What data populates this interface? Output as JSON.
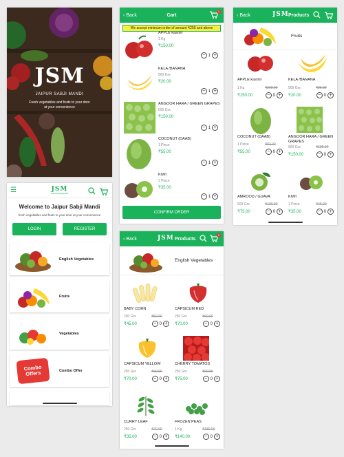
{
  "colors": {
    "brand": "#1ab25a",
    "notice": "#f8ee3c"
  },
  "splash": {
    "logo": "JSM",
    "brand": "JAIPUR SABJI MANDI",
    "tagline": "Fresh vegetables and fruits to your door at your convenience"
  },
  "home": {
    "logo": "JSM",
    "logo_sub": "JAIPUR SABJI MANDI",
    "welcome": "Welcome to Jaipur Sabji Mandi",
    "subtitle": "fresh vegetables and fruits to your door at your convenience",
    "login": "LOGIN",
    "register": "REGISTER",
    "categories": [
      {
        "label": "English Vegetables"
      },
      {
        "label": "Fruits"
      },
      {
        "label": "Vegetables"
      },
      {
        "label": "Combo Offer",
        "badge": "Combo Offers"
      }
    ]
  },
  "cart": {
    "back": "Back",
    "title": "Cart",
    "badge": "1",
    "notice": "We accept minimum order of amount ₹250 and above",
    "confirm": "CONFIRM ORDER",
    "items": [
      {
        "name": "APPLE kasmir",
        "unit": "1 Kg",
        "price": "₹150.00",
        "qty": "1"
      },
      {
        "name": "KELA /BANANA",
        "unit": "500 Grs",
        "price": "₹20.00",
        "qty": "1"
      },
      {
        "name": "ANGOOR HARA / GREEN GRAPES",
        "unit": "500 Grs",
        "price": "₹150.00",
        "qty": "1"
      },
      {
        "name": "COCONUT (DAAB)",
        "unit": "1 Piece",
        "price": "₹55.00",
        "qty": "1"
      },
      {
        "name": "KIWI",
        "unit": "1 Piece",
        "price": "₹35.00",
        "qty": "1"
      }
    ]
  },
  "fruits": {
    "back": "Back",
    "title": "Products",
    "logo": "JSM",
    "category": "Fruits",
    "items": [
      {
        "name": "APPLE kasmir",
        "unit": "1 Kg",
        "old": "₹200.00",
        "price": "₹150.00",
        "qty": "0"
      },
      {
        "name": "KELA /BANANA",
        "unit": "500 Grs",
        "old": "₹25.00",
        "price": "₹20.00",
        "qty": "0"
      },
      {
        "name": "COCONUT (DAAB)",
        "unit": "1 Piece",
        "old": "₹83.00",
        "price": "₹55.00",
        "qty": "0"
      },
      {
        "name": "ANGOOR HARA / GREEN GRAPES",
        "unit": "500 Grs",
        "old": "₹180.00",
        "price": "₹150.00",
        "qty": "0"
      },
      {
        "name": "AMROOD / GUAVA",
        "unit": "500 Grs",
        "old": "₹100.00",
        "price": "₹75.00",
        "qty": "0"
      },
      {
        "name": "KIWI",
        "unit": "1 Piece",
        "old": "₹45.00",
        "price": "₹35.00",
        "qty": "0"
      }
    ]
  },
  "veg": {
    "back": "Back",
    "title": "Products",
    "logo": "JSM",
    "badge": "0",
    "category": "English Vegetables",
    "items": [
      {
        "name": "BABY CORN",
        "unit": "200 Grs",
        "old": "₹50.00",
        "price": "₹45.00",
        "qty": "0"
      },
      {
        "name": "CAPSICUM RED",
        "unit": "250 Grs",
        "old": "₹90.00",
        "price": "₹70.00",
        "qty": "0"
      },
      {
        "name": "CAPSICUM YELLOW",
        "unit": "250 Grs",
        "old": "₹90.00",
        "price": "₹70.00",
        "qty": "0"
      },
      {
        "name": "CHERRY TOMATOS",
        "unit": "250 Grs",
        "old": "₹90.00",
        "price": "₹75.00",
        "qty": "0"
      },
      {
        "name": "CURRY LEAF",
        "unit": "250 Grs",
        "old": "₹70.00",
        "price": "₹35.00",
        "qty": "0"
      },
      {
        "name": "FROZEN PEAS",
        "unit": "1 Kg",
        "old": "₹180.00",
        "price": "₹140.00",
        "qty": "0"
      }
    ]
  }
}
